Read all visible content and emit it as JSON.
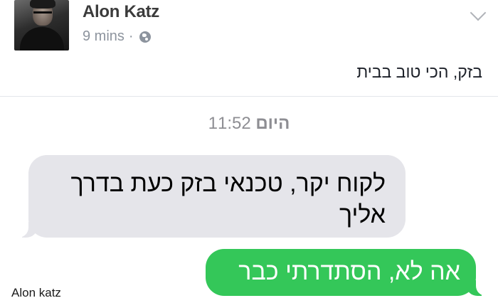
{
  "post": {
    "author_name": "Alon Katz",
    "time_ago": "9 mins",
    "separator": "·",
    "visibility_icon": "globe-icon",
    "menu_icon": "chevron-down-icon",
    "text": "בזק, הכי טוב בבית"
  },
  "conversation": {
    "day_label": "היום",
    "time": "11:52",
    "incoming_message": "לקוח יקר, טכנאי בזק כעת בדרך אליך",
    "outgoing_message": "אה לא, הסתדרתי כבר"
  },
  "watermark": "Alon katz",
  "colors": {
    "incoming_bubble": "#e5e5ea",
    "outgoing_bubble": "#34c759",
    "muted_text": "#8e8e93"
  }
}
